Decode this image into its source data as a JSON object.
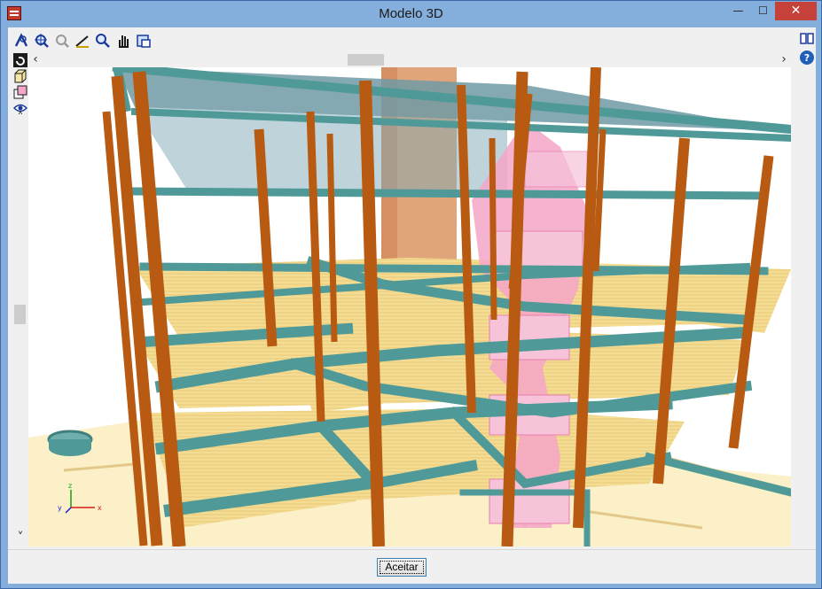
{
  "window": {
    "title": "Modelo 3D",
    "controls": {
      "minimize": "—",
      "maximize": "☐",
      "close": "✕"
    }
  },
  "toolbar": {
    "icons": [
      "rotate-icon",
      "zoom-window-icon",
      "zoom-extents-icon",
      "pan-line-icon",
      "zoom-icon",
      "hand-pan-icon",
      "export-icon"
    ]
  },
  "side_tools": {
    "icons": [
      "refresh-view-icon",
      "cube-icon",
      "layers-icon",
      "eye-icon"
    ]
  },
  "right_tools": {
    "icons": [
      "book-icon",
      "help-icon"
    ]
  },
  "scroll": {
    "left": "‹",
    "right": "›",
    "up": "˄",
    "down": "˅"
  },
  "axes": {
    "z": "z",
    "y": "y",
    "x": "x"
  },
  "footer": {
    "ok_label": "Aceitar"
  },
  "colors": {
    "titlebar": "#84aedc",
    "close_button": "#c7413b",
    "column": "#b85a12",
    "beam": "#4f9a98",
    "slab": "#f2d98a",
    "stair": "#f4a6c8",
    "core": "#e0a57a",
    "roof": "#6f9aa6"
  }
}
